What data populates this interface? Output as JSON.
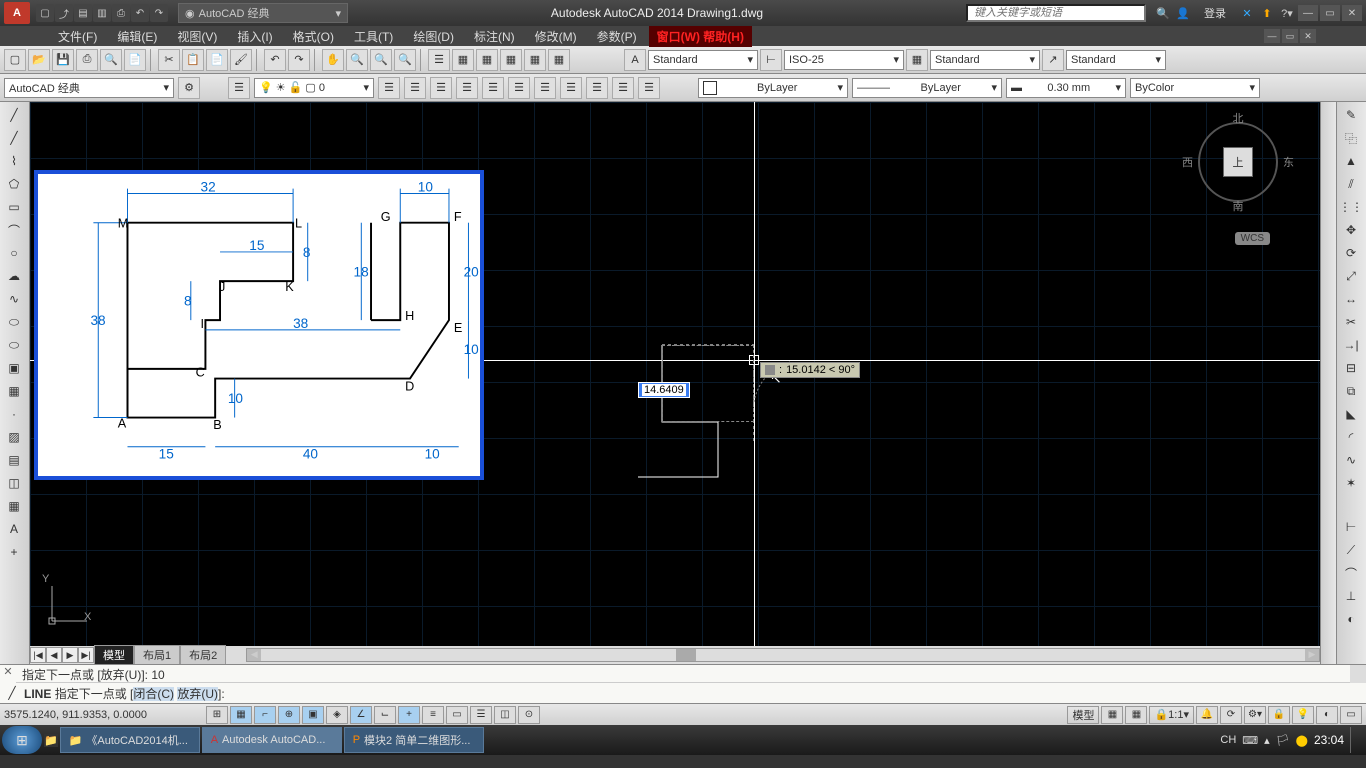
{
  "title_bar": {
    "app_title": "Autodesk AutoCAD 2014    Drawing1.dwg",
    "search_placeholder": "键入关键字或短语",
    "login": "登录",
    "workspace": "AutoCAD 经典"
  },
  "menus": [
    "文件(F)",
    "编辑(E)",
    "视图(V)",
    "插入(I)",
    "格式(O)",
    "工具(T)",
    "绘图(D)",
    "标注(N)",
    "修改(M)",
    "参数(P)"
  ],
  "menu_red": "窗口(W) 帮助(H)",
  "styles": {
    "text": "Standard",
    "dim": "ISO-25",
    "table": "Standard",
    "mleader": "Standard"
  },
  "layer_row": {
    "workspace": "AutoCAD 经典",
    "color": "ByLayer",
    "linetype": "ByLayer",
    "lineweight": "0.30 mm",
    "plotstyle": "ByColor"
  },
  "viewcube": {
    "n": "北",
    "s": "南",
    "e": "东",
    "w": "西",
    "top": "上",
    "wcs": "WCS"
  },
  "dynamic": {
    "length": "14.6409",
    "polar": "15.0142 < 90°"
  },
  "cmd": {
    "history_close_icon": "✕",
    "history": "指定下一点或 [放弃(U)]: 10",
    "active_cmd": "LINE",
    "prompt_prefix": "指定下一点或 [",
    "opt1": "闭合(C)",
    "sep": " ",
    "opt2": "放弃(U)",
    "prompt_suffix": "]:"
  },
  "tabs": {
    "model": "模型",
    "layout1": "布局1",
    "layout2": "布局2"
  },
  "status": {
    "coords": "3575.1240, 911.9353, 0.0000",
    "model": "模型",
    "scale": "1:1"
  },
  "taskbar": {
    "t1": "《AutoCAD2014机...",
    "t2": "Autodesk AutoCAD...",
    "t3": "模块2 简单二维图形...",
    "lang": "CH",
    "clock": "23:04"
  },
  "ref_dims": {
    "d32": "32",
    "d10a": "10",
    "d15a": "15",
    "d8a": "8",
    "d18": "18",
    "d20": "20",
    "d8b": "8",
    "d38a": "38",
    "d38b": "38",
    "d10b": "10",
    "d10c": "10",
    "d15b": "15",
    "d40": "40",
    "d10d": "10",
    "A": "A",
    "B": "B",
    "C": "C",
    "D": "D",
    "E": "E",
    "F": "F",
    "G": "G",
    "H": "H",
    "I": "I",
    "J": "J",
    "K": "K",
    "L": "L",
    "M": "M"
  },
  "ucs": {
    "x": "X",
    "y": "Y"
  }
}
